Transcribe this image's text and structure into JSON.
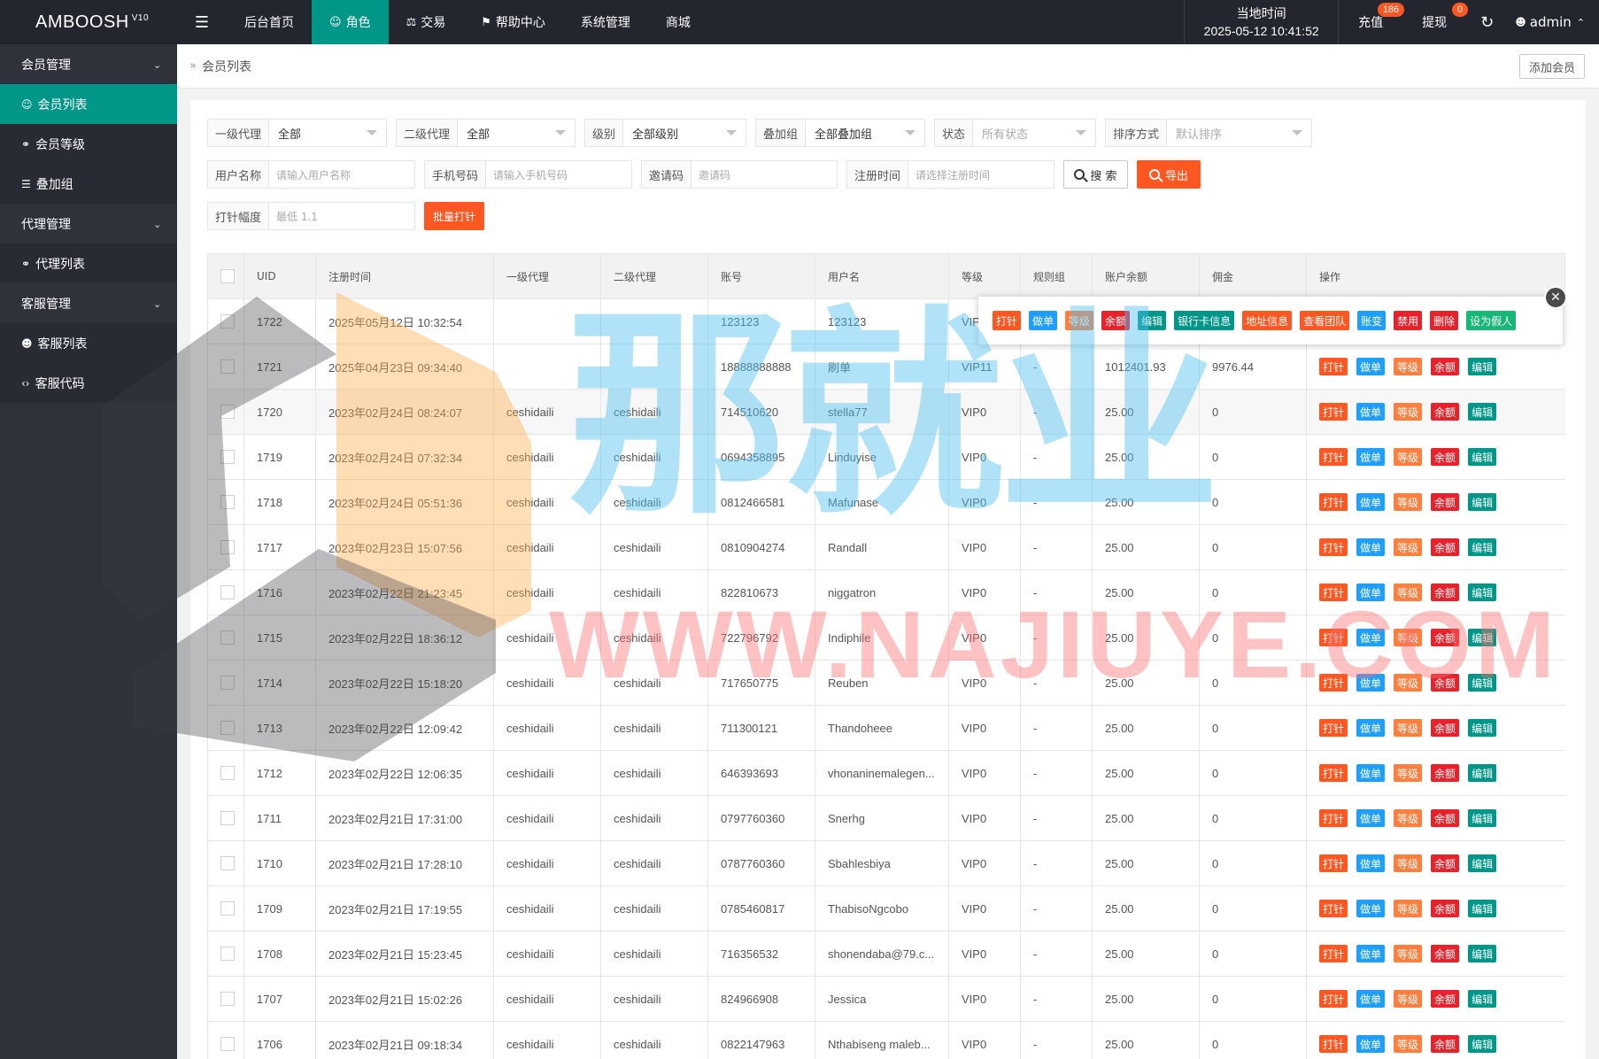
{
  "app": {
    "name": "AMBOOSH",
    "version": "V10"
  },
  "topnav": [
    {
      "label": "后台首页",
      "icon": "",
      "active": false
    },
    {
      "label": "角色",
      "icon": "user-icon",
      "active": true
    },
    {
      "label": "交易",
      "icon": "scale-icon",
      "active": false
    },
    {
      "label": "帮助中心",
      "icon": "flag-icon",
      "active": false
    },
    {
      "label": "系统管理",
      "icon": "",
      "active": false
    },
    {
      "label": "商城",
      "icon": "",
      "active": false
    }
  ],
  "clock": {
    "label": "当地时间",
    "value": "2025-05-12 10:41:52"
  },
  "recharge": {
    "label": "充值",
    "badge": "186"
  },
  "withdraw": {
    "label": "提现",
    "badge": "0"
  },
  "user": {
    "name": "admin"
  },
  "sidebar": [
    {
      "type": "group",
      "label": "会员管理"
    },
    {
      "type": "item",
      "label": "会员列表",
      "icon": "user-icon",
      "active": true
    },
    {
      "type": "item",
      "label": "会员等级",
      "icon": "link-icon",
      "active": false
    },
    {
      "type": "item",
      "label": "叠加组",
      "icon": "list-icon",
      "active": false
    },
    {
      "type": "group",
      "label": "代理管理"
    },
    {
      "type": "item",
      "label": "代理列表",
      "icon": "link-icon",
      "active": false
    },
    {
      "type": "group",
      "label": "客服管理"
    },
    {
      "type": "item",
      "label": "客服列表",
      "icon": "users-icon",
      "active": false
    },
    {
      "type": "item",
      "label": "客服代码",
      "icon": "code-icon",
      "active": false
    }
  ],
  "breadcrumb": "会员列表",
  "add_member": "添加会员",
  "filters": {
    "agent1": {
      "label": "一级代理",
      "value": "全部"
    },
    "agent2": {
      "label": "二级代理",
      "value": "全部"
    },
    "level": {
      "label": "级别",
      "value": "全部级别"
    },
    "stack": {
      "label": "叠加组",
      "value": "全部叠加组"
    },
    "status": {
      "label": "状态",
      "placeholder": "所有状态"
    },
    "sort": {
      "label": "排序方式",
      "placeholder": "默认排序"
    },
    "username": {
      "label": "用户名称",
      "placeholder": "请输入用户名称"
    },
    "phone": {
      "label": "手机号码",
      "placeholder": "请输入手机号码"
    },
    "invite": {
      "label": "邀请码",
      "placeholder": "邀请码"
    },
    "regtime": {
      "label": "注册时间",
      "placeholder": "请选择注册时间"
    },
    "search": "搜 索",
    "export": "导出",
    "shot": {
      "label": "打针幅度",
      "placeholder": "最低 1.1"
    },
    "batch": "批量打针"
  },
  "table": {
    "headers": [
      "UID",
      "注册时间",
      "一级代理",
      "二级代理",
      "账号",
      "用户名",
      "等级",
      "规则组",
      "账户余额",
      "佣金",
      "操作"
    ],
    "rows": [
      {
        "uid": "1722",
        "time": "2025年05月12日 10:32:54",
        "agent1": "",
        "agent2": "",
        "account": "123123",
        "name": "123123",
        "level": "VIP",
        "rule": "",
        "balance": "",
        "commission": ""
      },
      {
        "uid": "1721",
        "time": "2025年04月23日 09:34:40",
        "agent1": "",
        "agent2": "",
        "account": "18888888888",
        "name": "刷单",
        "level": "VIP11",
        "rule": "-",
        "balance": "1012401.93",
        "commission": "9976.44"
      },
      {
        "uid": "1720",
        "time": "2023年02月24日 08:24:07",
        "agent1": "ceshidaili",
        "agent2": "ceshidaili",
        "account": "714510620",
        "name": "stella77",
        "level": "VIP0",
        "rule": "-",
        "balance": "25.00",
        "commission": "0"
      },
      {
        "uid": "1719",
        "time": "2023年02月24日 07:32:34",
        "agent1": "ceshidaili",
        "agent2": "ceshidaili",
        "account": "0694358895",
        "name": "Linduyise",
        "level": "VIP0",
        "rule": "-",
        "balance": "25.00",
        "commission": "0"
      },
      {
        "uid": "1718",
        "time": "2023年02月24日 05:51:36",
        "agent1": "ceshidaili",
        "agent2": "ceshidaili",
        "account": "0812466581",
        "name": "Mafunase",
        "level": "VIP0",
        "rule": "-",
        "balance": "25.00",
        "commission": "0"
      },
      {
        "uid": "1717",
        "time": "2023年02月23日 15:07:56",
        "agent1": "ceshidaili",
        "agent2": "ceshidaili",
        "account": "0810904274",
        "name": "Randall",
        "level": "VIP0",
        "rule": "-",
        "balance": "25.00",
        "commission": "0"
      },
      {
        "uid": "1716",
        "time": "2023年02月22日 21:23:45",
        "agent1": "ceshidaili",
        "agent2": "ceshidaili",
        "account": "822810673",
        "name": "niggatron",
        "level": "VIP0",
        "rule": "-",
        "balance": "25.00",
        "commission": "0"
      },
      {
        "uid": "1715",
        "time": "2023年02月22日 18:36:12",
        "agent1": "ceshidaili",
        "agent2": "ceshidaili",
        "account": "722796792",
        "name": "Indiphile",
        "level": "VIP0",
        "rule": "-",
        "balance": "25.00",
        "commission": "0"
      },
      {
        "uid": "1714",
        "time": "2023年02月22日 15:18:20",
        "agent1": "ceshidaili",
        "agent2": "ceshidaili",
        "account": "717650775",
        "name": "Reuben",
        "level": "VIP0",
        "rule": "-",
        "balance": "25.00",
        "commission": "0"
      },
      {
        "uid": "1713",
        "time": "2023年02月22日 12:09:42",
        "agent1": "ceshidaili",
        "agent2": "ceshidaili",
        "account": "711300121",
        "name": "Thandoheee",
        "level": "VIP0",
        "rule": "-",
        "balance": "25.00",
        "commission": "0"
      },
      {
        "uid": "1712",
        "time": "2023年02月22日 12:06:35",
        "agent1": "ceshidaili",
        "agent2": "ceshidaili",
        "account": "646393693",
        "name": "vhonaninemalegen...",
        "level": "VIP0",
        "rule": "-",
        "balance": "25.00",
        "commission": "0"
      },
      {
        "uid": "1711",
        "time": "2023年02月21日 17:31:00",
        "agent1": "ceshidaili",
        "agent2": "ceshidaili",
        "account": "0797760360",
        "name": "Snerhg",
        "level": "VIP0",
        "rule": "-",
        "balance": "25.00",
        "commission": "0"
      },
      {
        "uid": "1710",
        "time": "2023年02月21日 17:28:10",
        "agent1": "ceshidaili",
        "agent2": "ceshidaili",
        "account": "0787760360",
        "name": "Sbahlesbiya",
        "level": "VIP0",
        "rule": "-",
        "balance": "25.00",
        "commission": "0"
      },
      {
        "uid": "1709",
        "time": "2023年02月21日 17:19:55",
        "agent1": "ceshidaili",
        "agent2": "ceshidaili",
        "account": "0785460817",
        "name": "ThabisoNgcobo",
        "level": "VIP0",
        "rule": "-",
        "balance": "25.00",
        "commission": "0"
      },
      {
        "uid": "1708",
        "time": "2023年02月21日 15:23:45",
        "agent1": "ceshidaili",
        "agent2": "ceshidaili",
        "account": "716356532",
        "name": "shonendaba@79.c...",
        "level": "VIP0",
        "rule": "-",
        "balance": "25.00",
        "commission": "0"
      },
      {
        "uid": "1707",
        "time": "2023年02月21日 15:02:26",
        "agent1": "ceshidaili",
        "agent2": "ceshidaili",
        "account": "824966908",
        "name": "Jessica",
        "level": "VIP0",
        "rule": "-",
        "balance": "25.00",
        "commission": "0"
      },
      {
        "uid": "1706",
        "time": "2023年02月21日 09:18:34",
        "agent1": "ceshidaili",
        "agent2": "ceshidaili",
        "account": "0822147963",
        "name": "Nthabiseng maleb...",
        "level": "VIP0",
        "rule": "-",
        "balance": "25.00",
        "commission": "0"
      }
    ]
  },
  "row_actions": [
    {
      "label": "打针",
      "color": "#ff5722"
    },
    {
      "label": "做单",
      "color": "#1e9fff"
    },
    {
      "label": "等级",
      "color": "#ff7f3f"
    },
    {
      "label": "余额",
      "color": "#e8212a"
    },
    {
      "label": "编辑",
      "color": "#009688"
    }
  ],
  "popup_actions": [
    {
      "label": "打针",
      "color": "#ff5722"
    },
    {
      "label": "做单",
      "color": "#1e9fff"
    },
    {
      "label": "等级",
      "color": "#ff7f3f"
    },
    {
      "label": "余额",
      "color": "#e8212a"
    },
    {
      "label": "编辑",
      "color": "#009688"
    },
    {
      "label": "银行卡信息",
      "color": "#009688"
    },
    {
      "label": "地址信息",
      "color": "#ff5722"
    },
    {
      "label": "查看团队",
      "color": "#ff5722"
    },
    {
      "label": "账变",
      "color": "#1e9fff"
    },
    {
      "label": "禁用",
      "color": "#e8212a"
    },
    {
      "label": "删除",
      "color": "#e8212a"
    },
    {
      "label": "设为假人",
      "color": "#16b777"
    }
  ],
  "watermark": {
    "cn": "那就业",
    "en": "WWW.NAJIUYE.COM"
  }
}
